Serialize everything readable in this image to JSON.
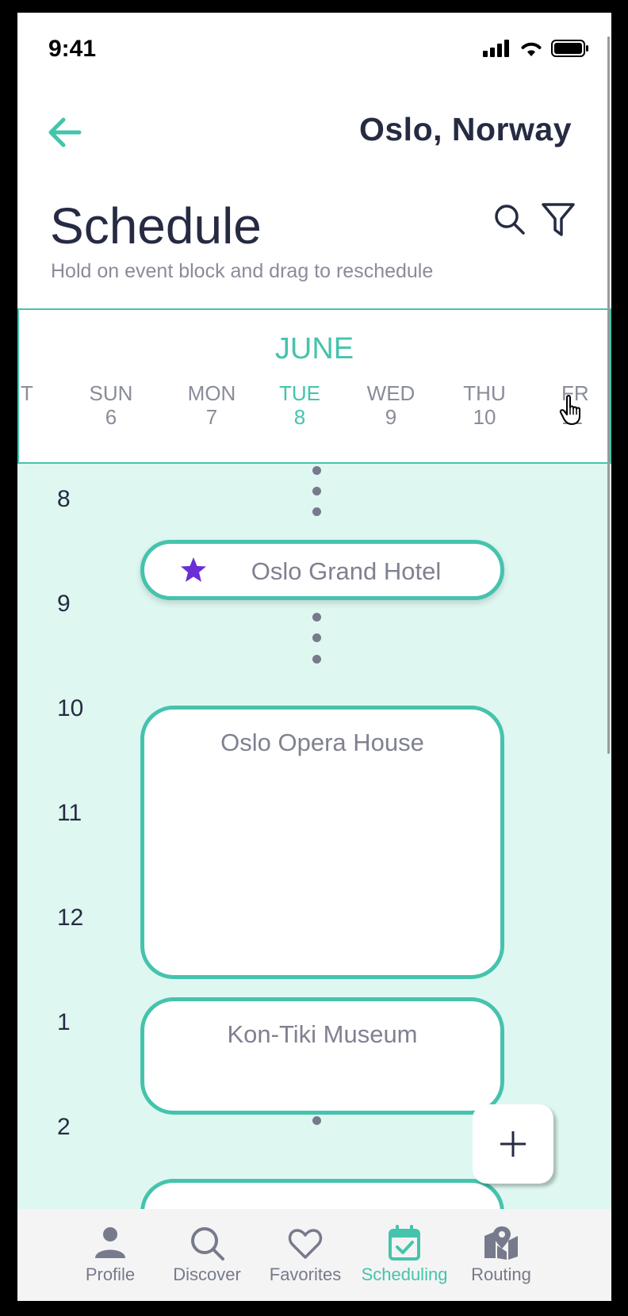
{
  "status_bar": {
    "time": "9:41"
  },
  "header": {
    "city": "Oslo, Norway"
  },
  "page": {
    "title": "Schedule",
    "subtitle": "Hold on event block and drag to reschedule"
  },
  "calendar": {
    "month": "JUNE",
    "days": [
      {
        "name": "T",
        "num": ""
      },
      {
        "name": "SUN",
        "num": "6"
      },
      {
        "name": "MON",
        "num": "7"
      },
      {
        "name": "TUE",
        "num": "8",
        "selected": true
      },
      {
        "name": "WED",
        "num": "9"
      },
      {
        "name": "THU",
        "num": "10"
      },
      {
        "name": "FR",
        "num": "11"
      }
    ]
  },
  "timeline": {
    "hours": [
      "8",
      "9",
      "10",
      "11",
      "12",
      "1",
      "2"
    ],
    "events": [
      {
        "name": "Oslo Grand Hotel",
        "icon": "star-icon",
        "favorite": true
      },
      {
        "name": "Oslo Opera House"
      },
      {
        "name": "Kon-Tiki Museum"
      },
      {
        "name": ""
      }
    ]
  },
  "fab": {
    "icon": "plus-icon"
  },
  "tabs": [
    {
      "label": "Profile",
      "icon": "person-icon"
    },
    {
      "label": "Discover",
      "icon": "search-icon"
    },
    {
      "label": "Favorites",
      "icon": "heart-icon"
    },
    {
      "label": "Scheduling",
      "icon": "calendar-check-icon",
      "active": true
    },
    {
      "label": "Routing",
      "icon": "map-pin-icon"
    }
  ],
  "colors": {
    "accent": "#45c3ad",
    "timeline_bg": "#dff7f1",
    "text_dark": "#262b43",
    "text_muted": "#8a8c99",
    "star": "#6a2fd6"
  }
}
